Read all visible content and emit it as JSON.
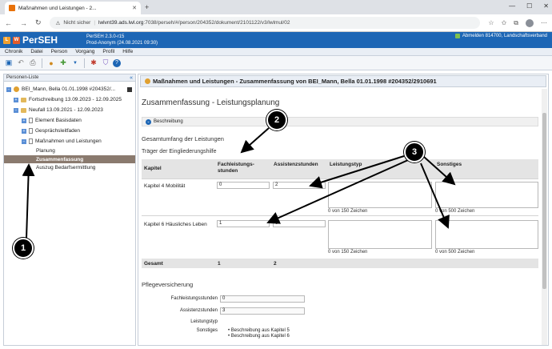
{
  "browser": {
    "tab_title": "Maßnahmen und Leistungen - 2...",
    "security": "Nicht sicher",
    "url_domain": "lwlvnt39.ads.lwl.org",
    "url_path": ":7038/perseh/#/person/204352/dokument/2101122/v3/lwlmul/02",
    "back_icon": "arrow-left",
    "forward_icon": "arrow-right",
    "reload_icon": "reload"
  },
  "app": {
    "logo": "PerSEH",
    "version_line1": "PerSEH 2.3.0-r15",
    "version_line2": "Prod-Anonym (24.08.2021 09:30)",
    "user": "Abmelden 814700, Landschaftsverband",
    "brand_color": "#1d66b5"
  },
  "menu": [
    "Chronik",
    "Datei",
    "Person",
    "Vorgang",
    "Profil",
    "Hilfe"
  ],
  "sidebar": {
    "header": "Personen-Liste",
    "collapse": "«",
    "person": "BEI_Mann, Bella 01.01.1998 #204352/...",
    "items": [
      {
        "label": "Fortschreibung 13.09.2023 - 12.09.2025"
      },
      {
        "label": "Neufall 13.09.2021 - 12.09.2023"
      },
      {
        "label": "Element Basisdaten"
      },
      {
        "label": "Gesprächsleitfaden"
      },
      {
        "label": "Maßnahmen und Leistungen"
      },
      {
        "label": "Planung"
      },
      {
        "label": "Zusammenfassung"
      },
      {
        "label": "Auszug Bedarfsermittlung"
      }
    ]
  },
  "main": {
    "header": "Maßnahmen und Leistungen - Zusammenfassung von  BEI_Mann, Bella 01.01.1998 #204352/2910691",
    "title": "Zusammenfassung - Leistungsplanung",
    "beschreibung": "Beschreibung",
    "section1": "Gesamtumfang der Leistungen",
    "section1_sub": "Träger der Eingliederungshilfe",
    "table": {
      "headers": [
        "Kapitel",
        "Fachleistungs-stunden",
        "Assistenzstunden",
        "Leistungstyp",
        "Sonstiges"
      ],
      "rows": [
        {
          "kapitel": "Kapitel 4 Mobilität",
          "fach": "0",
          "assist": "2",
          "typ_count": "0 von 150 Zeichen",
          "sonst_count": "0 von 500 Zeichen"
        },
        {
          "kapitel": "Kapitel 6 Häusliches Leben",
          "fach": "1",
          "assist": "0",
          "typ_count": "0 von 150 Zeichen",
          "sonst_count": "0 von 500 Zeichen"
        }
      ],
      "total_label": "Gesamt",
      "total_fach": "1",
      "total_assist": "2"
    },
    "section2": "Pflegeversicherung",
    "pflege": {
      "fach_label": "Fachleistungsstunden",
      "fach_value": "0",
      "assist_label": "Assistenzstunden",
      "assist_value": "3",
      "typ_label": "Leistungstyp",
      "sonst_label": "Sonstiges",
      "sonst_items": [
        "Beschreibung aus Kapitel 5",
        "Beschreibung aus Kapitel 6"
      ]
    }
  },
  "callouts": [
    "1",
    "2",
    "3"
  ]
}
